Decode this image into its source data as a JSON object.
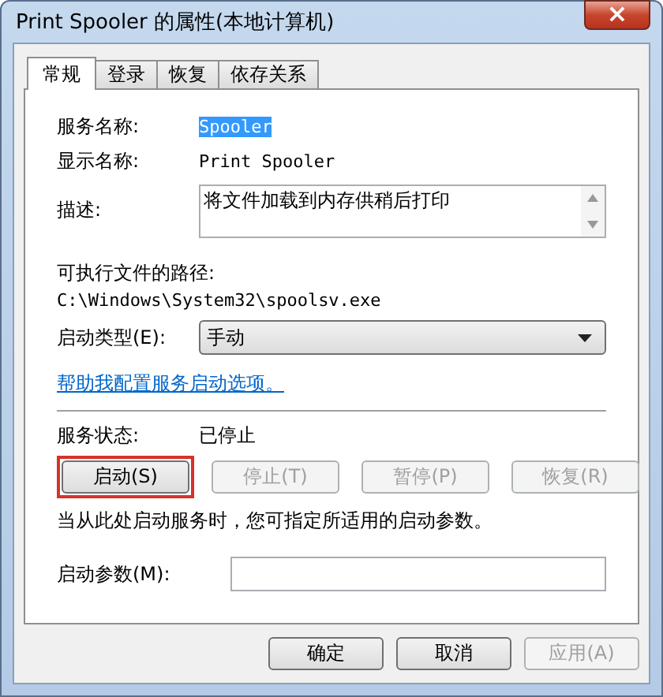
{
  "window": {
    "title": "Print Spooler 的属性(本地计算机)",
    "close": "×"
  },
  "tabs": [
    {
      "label": "常规",
      "selected": true
    },
    {
      "label": "登录",
      "selected": false
    },
    {
      "label": "恢复",
      "selected": false
    },
    {
      "label": "依存关系",
      "selected": false
    }
  ],
  "service_name": {
    "label": "服务名称:",
    "value": "Spooler",
    "text_selected": true
  },
  "display_name": {
    "label": "显示名称:",
    "value": "Print Spooler"
  },
  "description": {
    "label": "描述:",
    "value": "将文件加载到内存供稍后打印"
  },
  "path": {
    "label": "可执行文件的路径:",
    "value": "C:\\Windows\\System32\\spoolsv.exe"
  },
  "startup_type": {
    "label": "启动类型(E):",
    "value": "手动"
  },
  "help_link": "帮助我配置服务启动选项。",
  "status": {
    "label": "服务状态:",
    "value": "已停止"
  },
  "service_buttons": [
    {
      "label": "启动(S)",
      "disabled": false,
      "highlighted": true
    },
    {
      "label": "停止(T)",
      "disabled": true,
      "highlighted": false
    },
    {
      "label": "暂停(P)",
      "disabled": true,
      "highlighted": false
    },
    {
      "label": "恢复(R)",
      "disabled": true,
      "highlighted": false
    }
  ],
  "hint": "当从此处启动服务时，您可指定所适用的启动参数。",
  "start_params": {
    "label": "启动参数(M):"
  },
  "dialog_buttons": [
    {
      "label": "确定",
      "disabled": false
    },
    {
      "label": "取消",
      "disabled": false
    },
    {
      "label": "应用(A)",
      "disabled": true
    }
  ]
}
